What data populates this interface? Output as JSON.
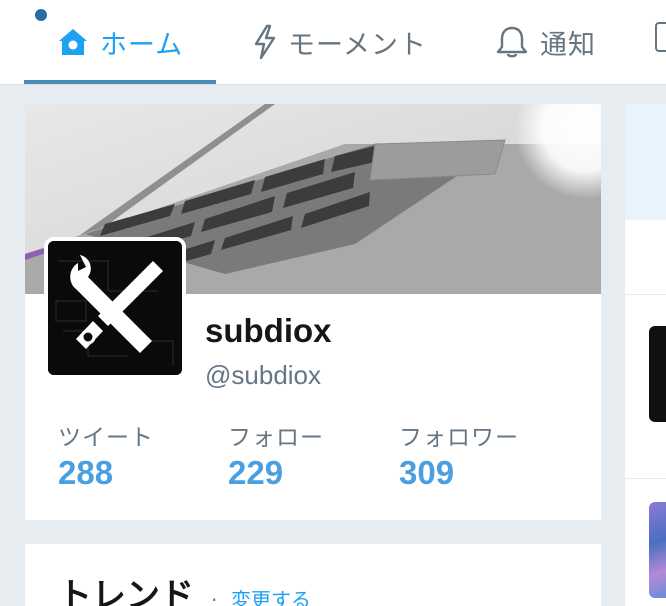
{
  "nav": {
    "home_label": "ホーム",
    "moments_label": "モーメント",
    "notifications_label": "通知",
    "home_icon": "home-icon",
    "moments_icon": "lightning-icon",
    "notifications_icon": "bell-icon",
    "messages_icon": "mail-icon"
  },
  "profile": {
    "name": "subdiox",
    "handle": "@subdiox",
    "stats": {
      "tweets_label": "ツイート",
      "tweets_value": "288",
      "following_label": "フォロー",
      "following_value": "229",
      "followers_label": "フォロワー",
      "followers_value": "309"
    }
  },
  "trends": {
    "title": "トレンド",
    "separator": "·",
    "change_label": "変更する"
  },
  "colors": {
    "accent": "#1da1f2",
    "stat_value": "#4a9fe0",
    "background": "#e6ecf0"
  }
}
